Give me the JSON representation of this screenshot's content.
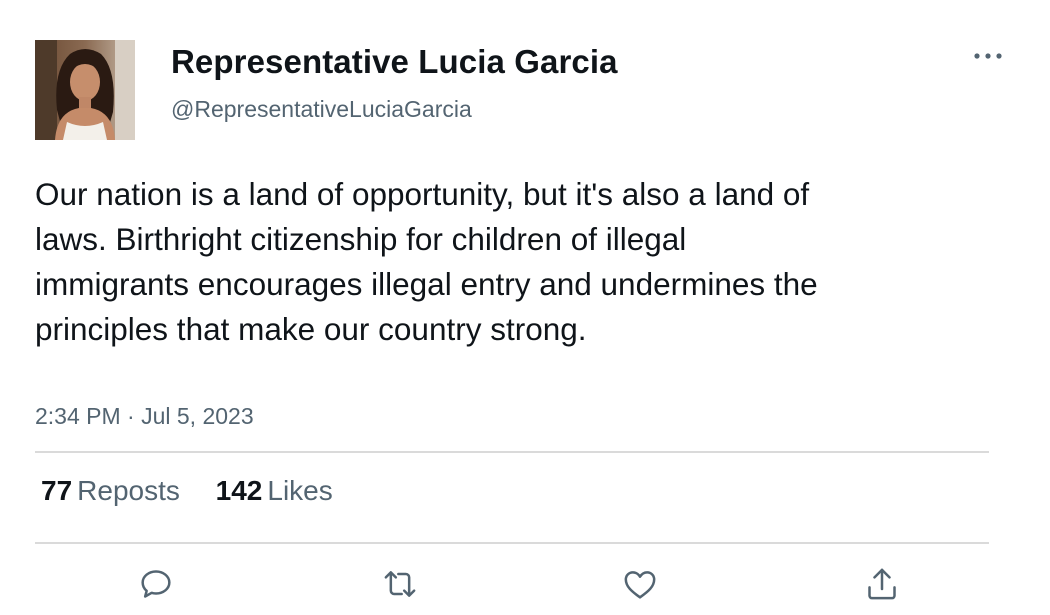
{
  "author": {
    "display_name": "Representative Lucia Garcia",
    "handle": "@RepresentativeLuciaGarcia"
  },
  "tweet": {
    "text": "Our nation is a land of opportunity, but it's also a land of laws. Birthright citizenship for children of illegal immigrants encourages illegal entry and undermines the principles that make our country strong.",
    "timestamp": "2:34 PM · Jul 5, 2023"
  },
  "stats": {
    "reposts_count": "77",
    "reposts_label": "Reposts",
    "likes_count": "142",
    "likes_label": "Likes"
  },
  "actions": {
    "icons": [
      "reply-icon",
      "repost-icon",
      "like-icon",
      "share-icon"
    ]
  },
  "colors": {
    "text_primary": "#0f1419",
    "text_secondary": "#536471",
    "divider": "#dadada",
    "icon": "#536471"
  }
}
